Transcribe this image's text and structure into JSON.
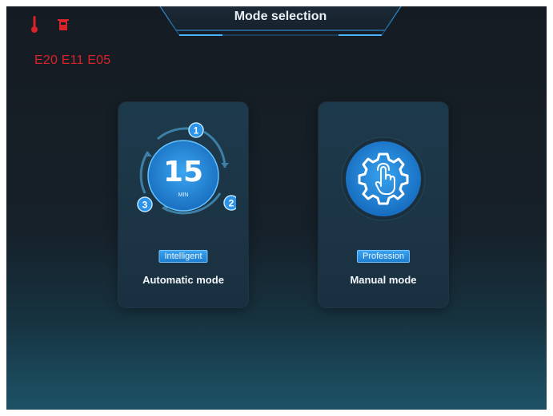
{
  "header": {
    "title": "Mode selection"
  },
  "status": {
    "icons": [
      "thermometer-icon",
      "tank-icon"
    ],
    "error_codes": "E20 E11 E05",
    "error_color": "#d8232a"
  },
  "modes": [
    {
      "badge": "Intelligent",
      "label": "Automatic mode",
      "dial_value": "15",
      "dial_unit": "MIN",
      "steps": [
        "1",
        "2",
        "3"
      ]
    },
    {
      "badge": "Profession",
      "label": "Manual mode",
      "icon": "gear-touch-icon"
    }
  ],
  "colors": {
    "accent": "#2a8fe6",
    "badge_border": "#7cc6ff"
  }
}
